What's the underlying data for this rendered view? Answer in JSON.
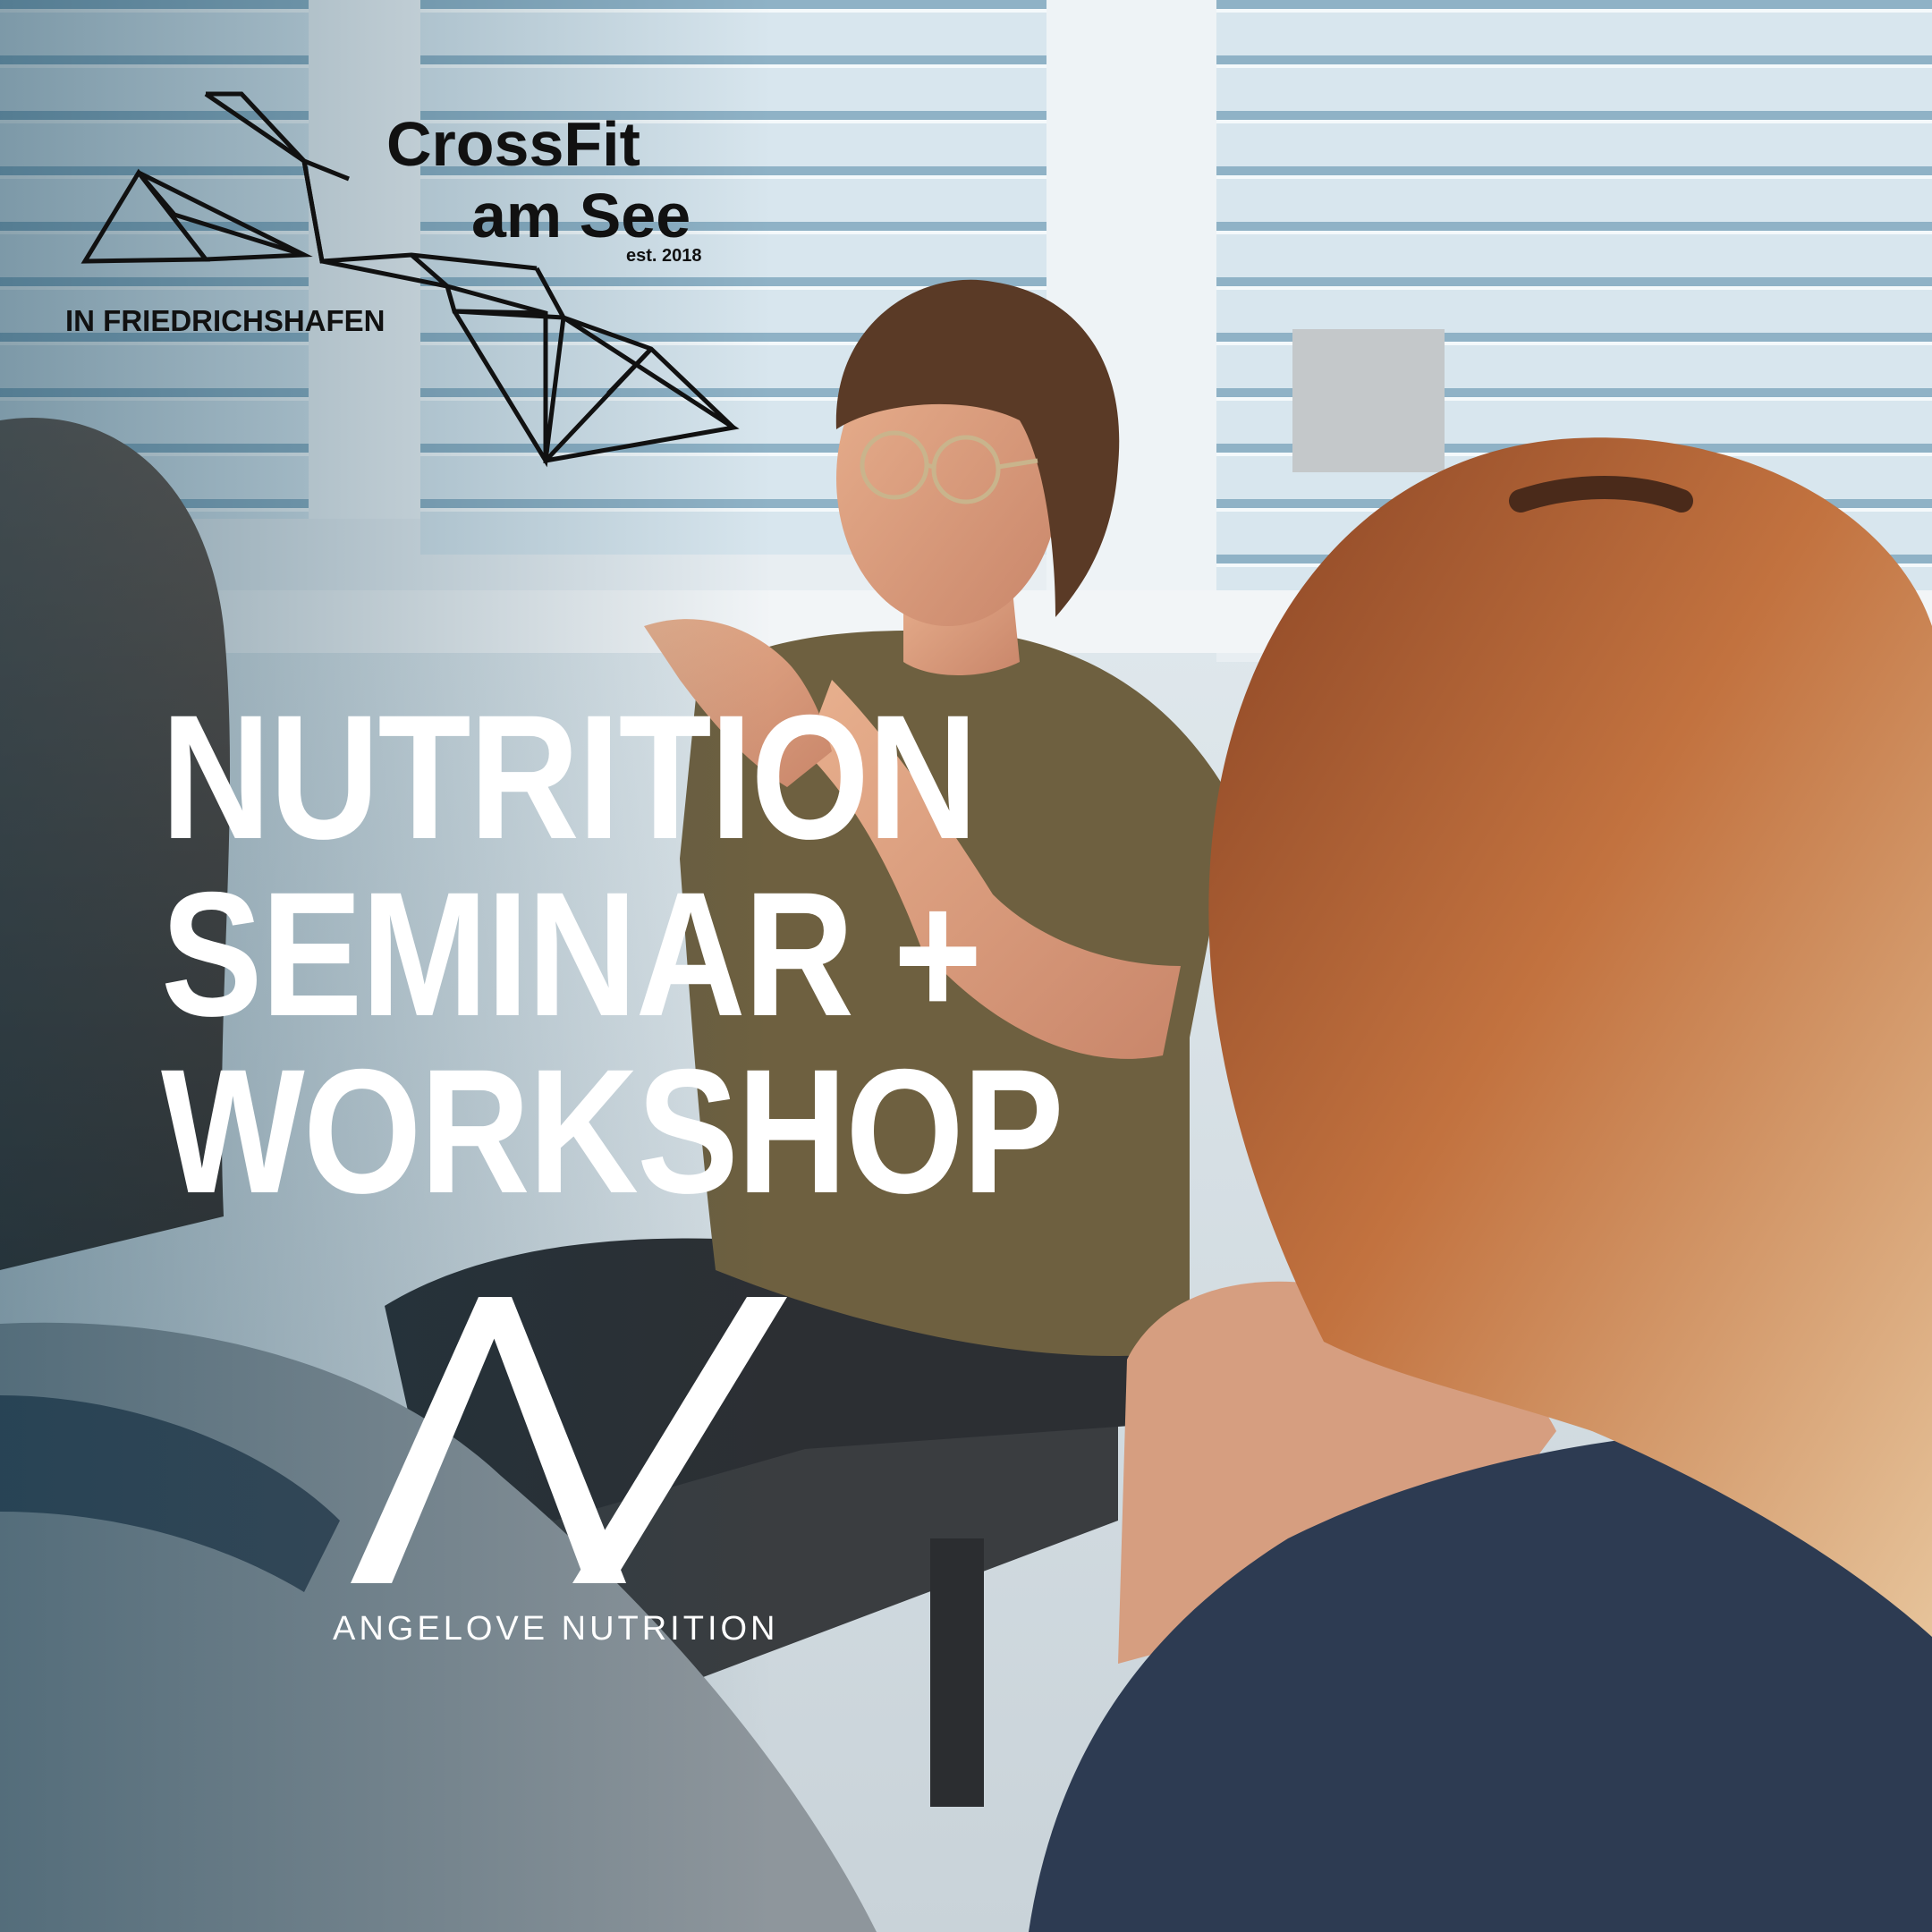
{
  "crossfit_logo": {
    "line1": "CrossFit",
    "line2": "am See",
    "established": "est. 2018",
    "location": "IN FRIEDRICHSHAFEN"
  },
  "headline": {
    "line1": "NUTRITION",
    "line2": "SEMINAR +",
    "line3": "WORKSHOP"
  },
  "nutrition_logo": {
    "name": "ANGELOVE NUTRITION"
  },
  "colors": {
    "text_white": "#ffffff",
    "logo_black": "#111111",
    "shirt_olive": "#6e6040",
    "hair_auburn": "#b86a3c",
    "blinds_blue": "#c9dbe6"
  }
}
